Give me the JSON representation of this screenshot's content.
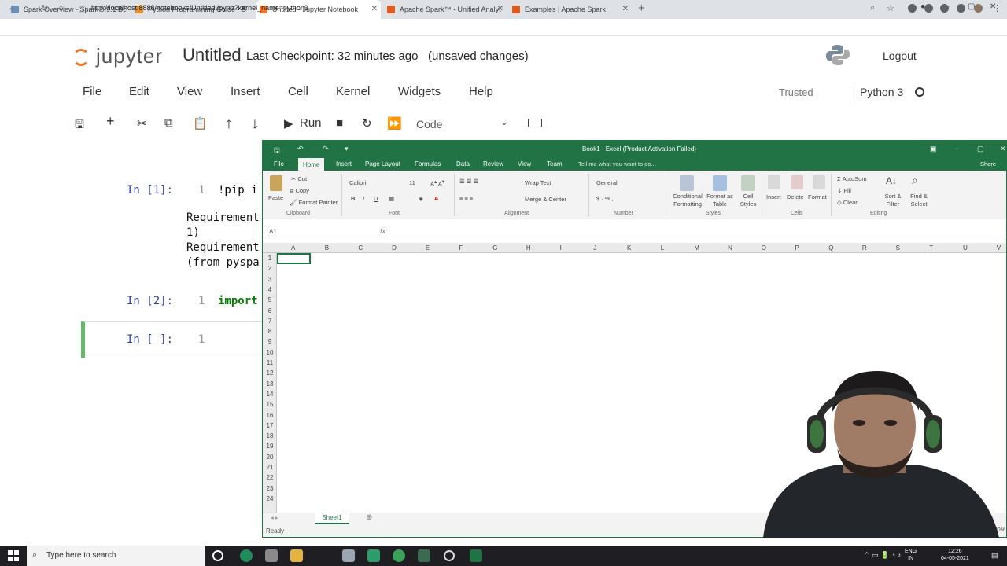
{
  "browser": {
    "tabs": [
      {
        "title": "Spark Overview - Spark 0.9.1 Do",
        "color": "#6d8fb5"
      },
      {
        "title": "Python Programming Guide - S",
        "color": "#e28e2b"
      },
      {
        "title": "Untitled - Jupyter Notebook",
        "color": "#f37726"
      },
      {
        "title": "Apache Spark™ - Unified Analyt",
        "color": "#e25a1c"
      },
      {
        "title": "Examples | Apache Spark",
        "color": "#e25a1c"
      }
    ],
    "new_tab": "+",
    "url": "http://localhost:8888/notebooks/Untitled.ipynb?kernel_name=python3"
  },
  "jupyter": {
    "logo_text": "jupyter",
    "notebook_title": "Untitled",
    "checkpoint": "Last Checkpoint: 32 minutes ago",
    "unsaved": "(unsaved changes)",
    "logout": "Logout",
    "menu": [
      "File",
      "Edit",
      "View",
      "Insert",
      "Cell",
      "Kernel",
      "Widgets",
      "Help"
    ],
    "trusted": "Trusted",
    "kernel_name": "Python 3",
    "toolbar": {
      "run": "Run",
      "cell_type": "Code"
    },
    "cells": [
      {
        "prompt": "In [1]:",
        "line": "1",
        "code": "!pip i"
      },
      {
        "prompt": "In [2]:",
        "line": "1",
        "code": "import"
      },
      {
        "prompt": "In [ ]:",
        "line": "1",
        "code": ""
      }
    ],
    "output_lines": [
      "Requirement",
      "1)",
      "Requirement",
      "(from pyspa"
    ]
  },
  "excel": {
    "title": "Book1 - Excel (Product Activation Failed)",
    "ribbon_tabs": [
      "File",
      "Home",
      "Insert",
      "Page Layout",
      "Formulas",
      "Data",
      "Review",
      "View",
      "Team"
    ],
    "tell_me": "Tell me what you want to do...",
    "share": "Share",
    "clipboard": {
      "paste": "Paste",
      "cut": "Cut",
      "copy": "Copy",
      "format_painter": "Format Painter",
      "group": "Clipboard"
    },
    "font": {
      "name": "Calibri",
      "size": "11",
      "group": "Font"
    },
    "alignment": {
      "wrap": "Wrap Text",
      "merge": "Merge & Center",
      "group": "Alignment"
    },
    "number": {
      "format": "General",
      "group": "Number"
    },
    "styles": {
      "conditional": "Conditional Formatting",
      "format_as_table": "Format as Table",
      "cell_styles": "Cell Styles",
      "group": "Styles"
    },
    "cells": {
      "insert": "Insert",
      "delete": "Delete",
      "format": "Format",
      "group": "Cells"
    },
    "editing": {
      "autosum": "AutoSum",
      "fill": "Fill",
      "clear": "Clear",
      "sort": "Sort & Filter",
      "find": "Find & Select",
      "group": "Editing"
    },
    "name_box": "A1",
    "fx": "fx",
    "columns": [
      "A",
      "B",
      "C",
      "D",
      "E",
      "F",
      "G",
      "H",
      "I",
      "J",
      "K",
      "L",
      "M",
      "N",
      "O",
      "P",
      "Q",
      "R",
      "S",
      "T",
      "U",
      "V"
    ],
    "rows": [
      "1",
      "2",
      "3",
      "4",
      "5",
      "6",
      "7",
      "8",
      "9",
      "10",
      "11",
      "12",
      "13",
      "14",
      "15",
      "16",
      "17",
      "18",
      "19",
      "20",
      "21",
      "22",
      "23",
      "24"
    ],
    "sheet": "Sheet1",
    "status": "Ready",
    "zoom": "100%"
  },
  "taskbar": {
    "search_placeholder": "Type here to search",
    "lang": "ENG",
    "region": "IN",
    "time": "12:26",
    "date": "04-05-2021"
  }
}
